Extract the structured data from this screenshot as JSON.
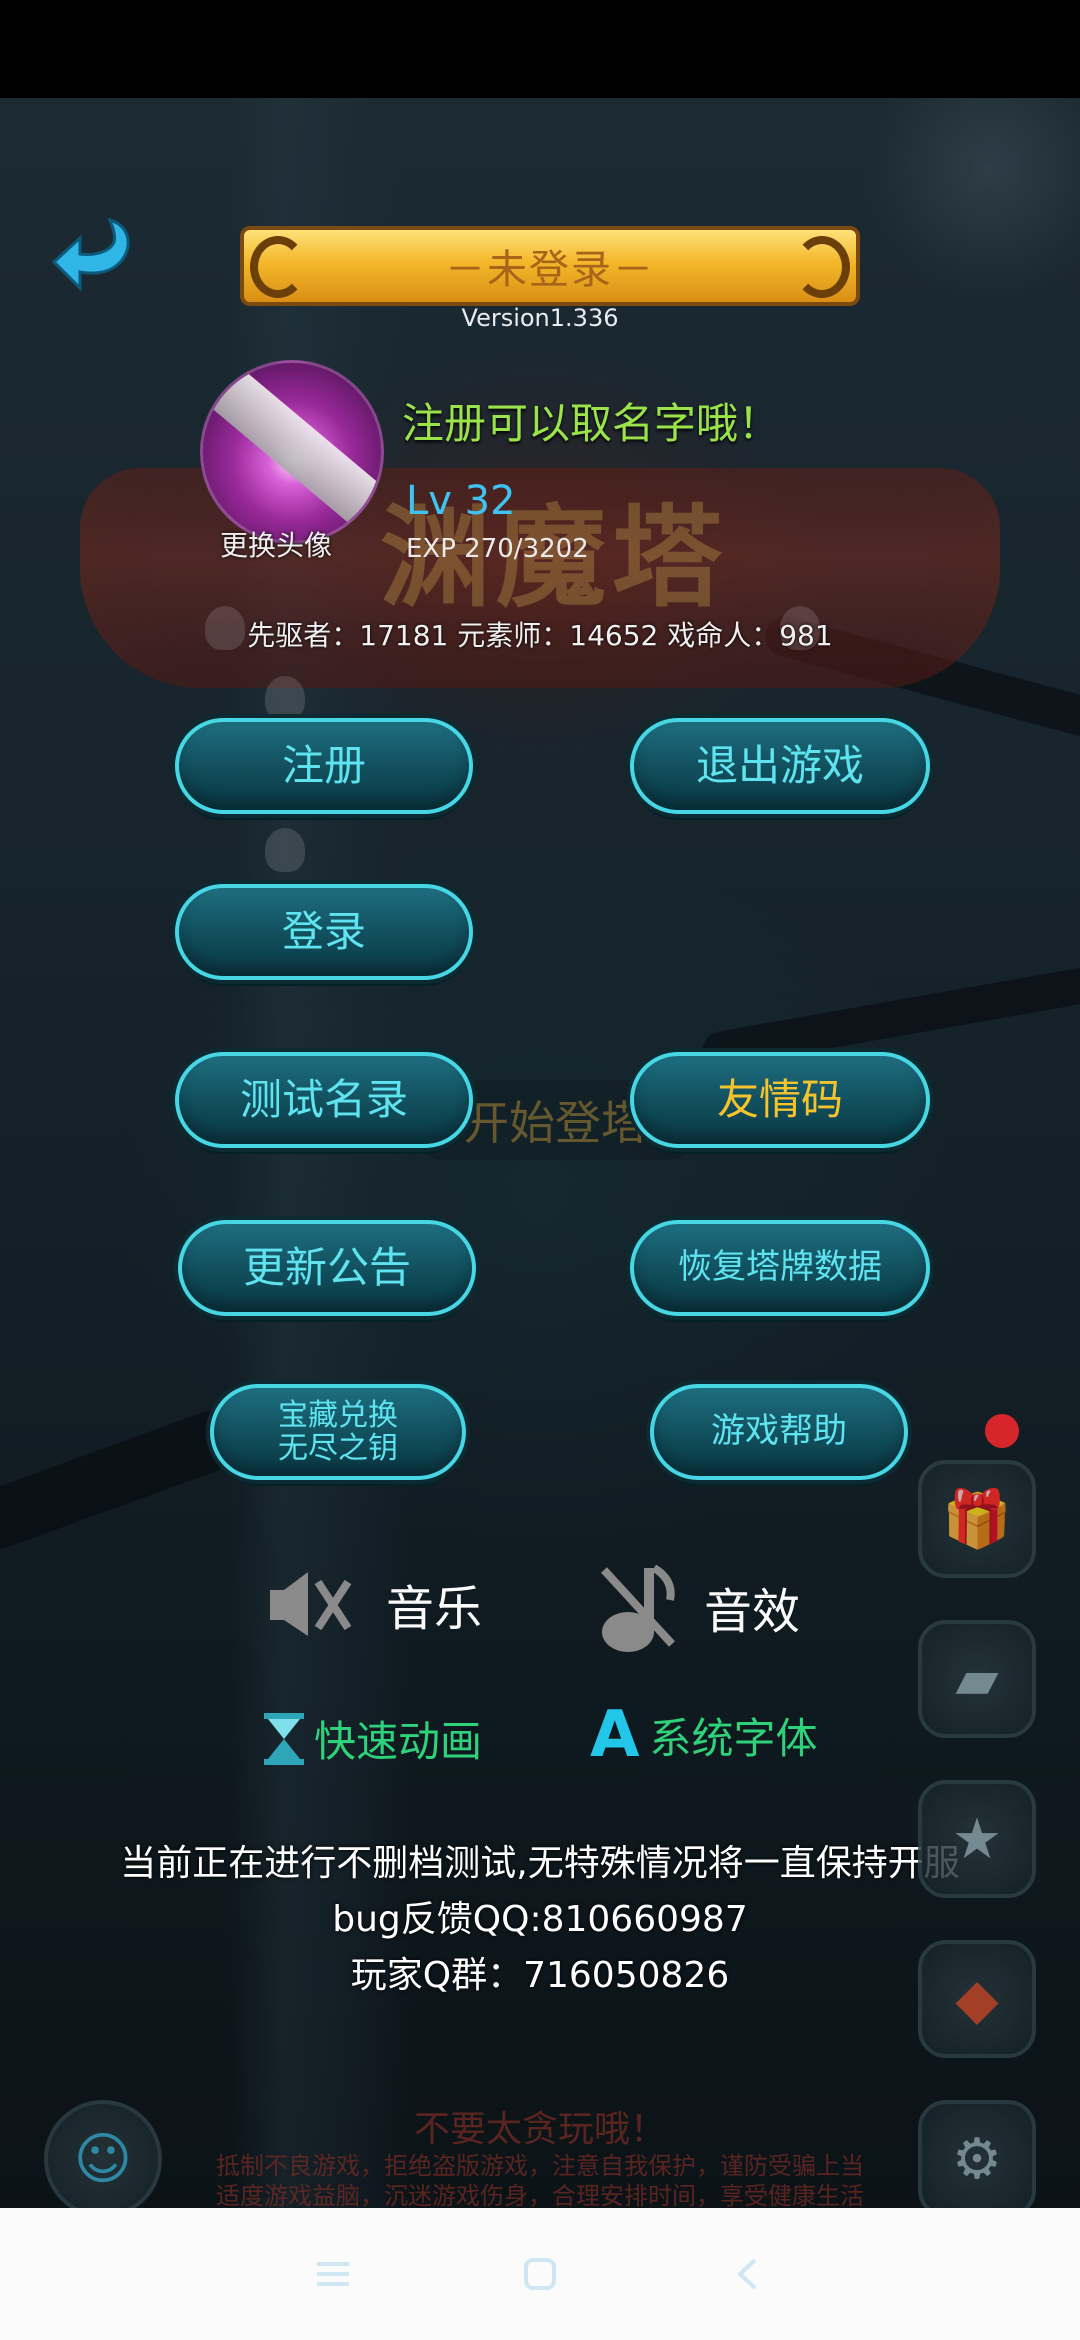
{
  "header": {
    "title": "－未登录－",
    "version": "Version1.336"
  },
  "banner": {
    "game_title": "渊魔塔"
  },
  "profile": {
    "avatar_label": "更换头像",
    "slogan": "注册可以取名字哦！",
    "level": "Lv  32",
    "exp": "EXP   270/3202"
  },
  "counts": "先驱者：17181   元素师：14652   戏命人：981",
  "buttons": {
    "register": "注册",
    "exit_game": "退出游戏",
    "login": "登录",
    "test_list": "测试名录",
    "friend_code": "友情码",
    "update_notice": "更新公告",
    "restore_tower_data": "恢复塔牌数据",
    "treasure_line1": "宝藏兑换",
    "treasure_line2": "无尽之钥",
    "game_help": "游戏帮助"
  },
  "watermark_text": "开始登塔",
  "toggles": {
    "music": "音乐",
    "sound_effects": "音效",
    "fast_animation": "快速动画",
    "system_font": "系统字体"
  },
  "notice": {
    "line1": "当前正在进行不删档测试,无特殊情况将一直保持开服",
    "line2": "bug反馈QQ:810660987",
    "line3": "玩家Q群：716050826"
  },
  "footer": {
    "warning_title": "不要太贪玩哦！",
    "warning_line1": "抵制不良游戏，拒绝盗版游戏，注意自我保护，谨防受骗上当",
    "warning_line2": "适度游戏益脑，沉迷游戏伤身，合理安排时间，享受健康生活"
  },
  "colors": {
    "pill_text": "#5ee3ef",
    "pill_gold_text": "#f5c42d",
    "slogan": "#9be34a",
    "level": "#3ec4f2",
    "toggle_green": "#2fd17a"
  },
  "icons": {
    "back": "back-arrow-icon",
    "music_muted": "speaker-muted-icon",
    "sfx_muted": "note-muted-icon",
    "hourglass": "hourglass-icon",
    "font": "letter-a-icon",
    "gift": "gift-icon",
    "cards": "cards-icon",
    "trophy": "trophy-icon",
    "red_packet": "red-packet-icon",
    "settings": "gear-icon",
    "emoji": "smiley-icon",
    "nav_menu": "menu-icon",
    "nav_home": "home-icon",
    "nav_back": "back-icon"
  }
}
